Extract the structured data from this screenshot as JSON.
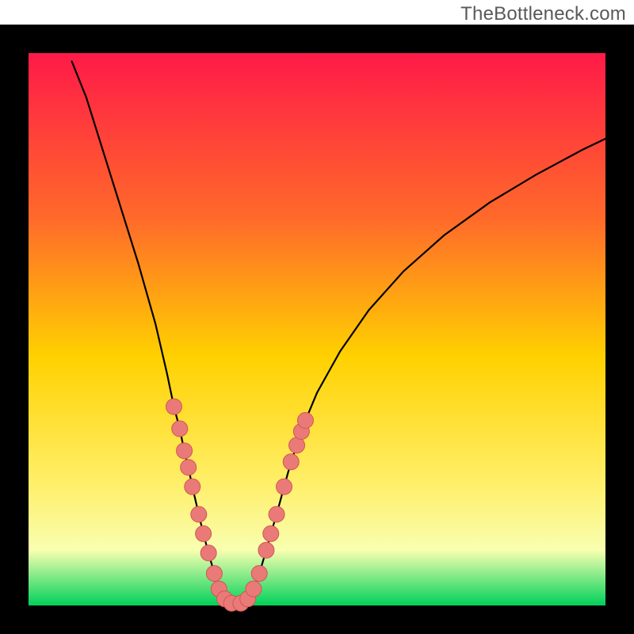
{
  "watermark": "TheBottleneck.com",
  "chart_data": {
    "type": "line",
    "title": "",
    "xlabel": "",
    "ylabel": "",
    "xlim": [
      0,
      100
    ],
    "ylim": [
      0,
      100
    ],
    "gradient": {
      "top": "#ff1a48",
      "mid_upper": "#ff6a2a",
      "mid": "#ffd100",
      "mid_lower": "#ffef6a",
      "low": "#f8ffb0",
      "bottom": "#00d15a"
    },
    "series": [
      {
        "name": "curve",
        "stroke": "#000000",
        "points": [
          {
            "x": 7.5,
            "y": 98.5
          },
          {
            "x": 10.0,
            "y": 92.0
          },
          {
            "x": 13.0,
            "y": 82.0
          },
          {
            "x": 16.0,
            "y": 72.0
          },
          {
            "x": 19.0,
            "y": 62.0
          },
          {
            "x": 22.0,
            "y": 51.0
          },
          {
            "x": 24.0,
            "y": 42.0
          },
          {
            "x": 25.2,
            "y": 36.0
          },
          {
            "x": 26.2,
            "y": 32.0
          },
          {
            "x": 27.0,
            "y": 28.0
          },
          {
            "x": 27.7,
            "y": 25.0
          },
          {
            "x": 28.4,
            "y": 21.5
          },
          {
            "x": 29.5,
            "y": 16.5
          },
          {
            "x": 30.3,
            "y": 13.0
          },
          {
            "x": 31.2,
            "y": 9.5
          },
          {
            "x": 32.2,
            "y": 5.8
          },
          {
            "x": 33.0,
            "y": 3.0
          },
          {
            "x": 34.0,
            "y": 1.2
          },
          {
            "x": 35.2,
            "y": 0.4
          },
          {
            "x": 36.8,
            "y": 0.4
          },
          {
            "x": 38.0,
            "y": 1.2
          },
          {
            "x": 39.0,
            "y": 3.0
          },
          {
            "x": 40.0,
            "y": 5.8
          },
          {
            "x": 41.2,
            "y": 10.0
          },
          {
            "x": 42.0,
            "y": 13.0
          },
          {
            "x": 43.0,
            "y": 16.5
          },
          {
            "x": 44.3,
            "y": 21.5
          },
          {
            "x": 45.5,
            "y": 26.0
          },
          {
            "x": 46.5,
            "y": 29.0
          },
          {
            "x": 47.3,
            "y": 31.5
          },
          {
            "x": 48.0,
            "y": 33.5
          },
          {
            "x": 50.0,
            "y": 38.5
          },
          {
            "x": 54.0,
            "y": 46.0
          },
          {
            "x": 59.0,
            "y": 53.5
          },
          {
            "x": 65.0,
            "y": 60.5
          },
          {
            "x": 72.0,
            "y": 67.0
          },
          {
            "x": 80.0,
            "y": 73.0
          },
          {
            "x": 88.0,
            "y": 78.0
          },
          {
            "x": 96.0,
            "y": 82.5
          },
          {
            "x": 100.0,
            "y": 84.5
          }
        ]
      }
    ],
    "markers": {
      "fill": "#ea7a78",
      "stroke": "#d05654",
      "radius_pct": 1.25,
      "points": [
        {
          "x": 25.2,
          "y": 36.0
        },
        {
          "x": 26.2,
          "y": 32.0
        },
        {
          "x": 27.0,
          "y": 28.0
        },
        {
          "x": 27.7,
          "y": 25.0
        },
        {
          "x": 28.4,
          "y": 21.5
        },
        {
          "x": 29.5,
          "y": 16.5
        },
        {
          "x": 30.3,
          "y": 13.0
        },
        {
          "x": 31.2,
          "y": 9.5
        },
        {
          "x": 32.2,
          "y": 5.8
        },
        {
          "x": 33.0,
          "y": 3.0
        },
        {
          "x": 34.0,
          "y": 1.2
        },
        {
          "x": 35.2,
          "y": 0.4
        },
        {
          "x": 36.8,
          "y": 0.4
        },
        {
          "x": 38.0,
          "y": 1.2
        },
        {
          "x": 39.0,
          "y": 3.0
        },
        {
          "x": 40.0,
          "y": 5.8
        },
        {
          "x": 41.2,
          "y": 10.0
        },
        {
          "x": 42.0,
          "y": 13.0
        },
        {
          "x": 43.0,
          "y": 16.5
        },
        {
          "x": 44.3,
          "y": 21.5
        },
        {
          "x": 45.5,
          "y": 26.0
        },
        {
          "x": 46.5,
          "y": 29.0
        },
        {
          "x": 47.3,
          "y": 31.5
        },
        {
          "x": 48.0,
          "y": 33.5
        }
      ]
    },
    "border": {
      "thickness_pct": 4.5,
      "color": "#000000"
    }
  }
}
